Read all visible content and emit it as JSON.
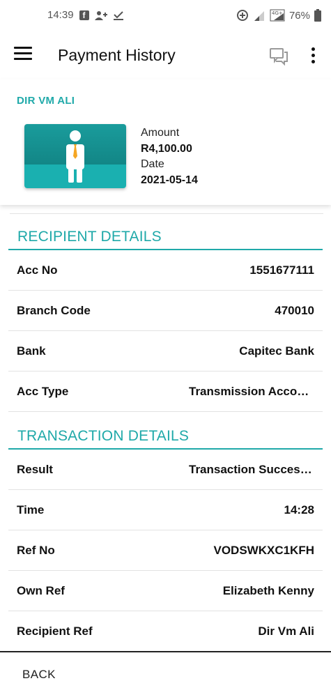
{
  "status_bar": {
    "time": "14:39",
    "battery": "76%",
    "network": "4G+"
  },
  "app_bar": {
    "title": "Payment History"
  },
  "payment": {
    "recipient_name": "DIR VM ALI",
    "amount_label": "Amount",
    "amount_value": "R4,100.00",
    "date_label": "Date",
    "date_value": "2021-05-14"
  },
  "recipient_details": {
    "title": "RECIPIENT DETAILS",
    "rows": [
      {
        "label": "Acc No",
        "value": "1551677111"
      },
      {
        "label": "Branch Code",
        "value": "470010"
      },
      {
        "label": "Bank",
        "value": "Capitec Bank"
      },
      {
        "label": "Acc Type",
        "value": "Transmission Account"
      }
    ]
  },
  "transaction_details": {
    "title": "TRANSACTION DETAILS",
    "rows": [
      {
        "label": "Result",
        "value": "Transaction Successful"
      },
      {
        "label": "Time",
        "value": "14:28"
      },
      {
        "label": "Ref No",
        "value": "VODSWKXC1KFH"
      },
      {
        "label": "Own Ref",
        "value": "Elizabeth Kenny"
      },
      {
        "label": "Recipient Ref",
        "value": "Dir Vm Ali"
      }
    ]
  },
  "footer": {
    "back_label": "BACK"
  },
  "colors": {
    "accent": "#1fa9a9",
    "avatar_dark": "#128686",
    "avatar_light": "#1ab0b0",
    "tie": "#f5a623"
  }
}
